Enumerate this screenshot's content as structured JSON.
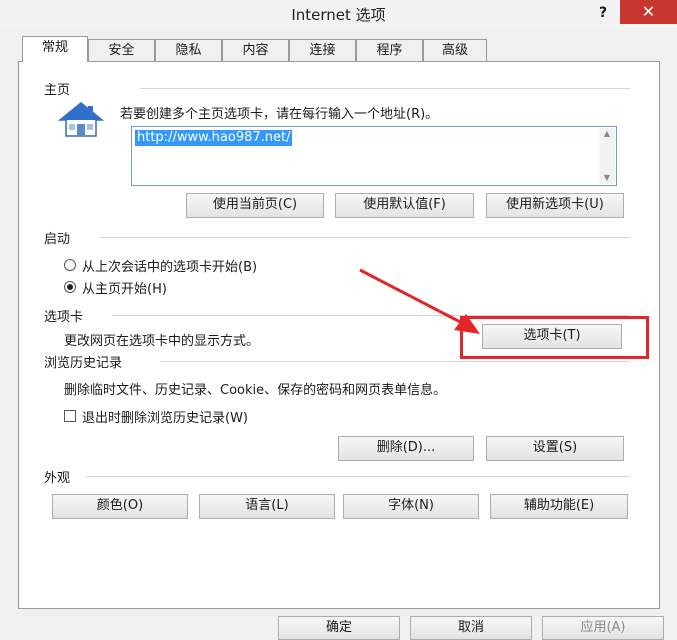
{
  "window": {
    "title": "Internet 选项",
    "help": "?",
    "close": "✕"
  },
  "tabs": [
    "常规",
    "安全",
    "隐私",
    "内容",
    "连接",
    "程序",
    "高级"
  ],
  "homepage": {
    "label": "主页",
    "instruction": "若要创建多个主页选项卡，请在每行输入一个地址(R)。",
    "url": "http://www.hao987.net/",
    "btn_current": "使用当前页(C)",
    "btn_default": "使用默认值(F)",
    "btn_new_tab": "使用新选项卡(U)"
  },
  "startup": {
    "label": "启动",
    "option_last_session": "从上次会话中的选项卡开始(B)",
    "option_homepage": "从主页开始(H)",
    "selected": "homepage"
  },
  "tabs_section": {
    "label": "选项卡",
    "description": "更改网页在选项卡中的显示方式。",
    "button": "选项卡(T)"
  },
  "history": {
    "label": "浏览历史记录",
    "description": "删除临时文件、历史记录、Cookie、保存的密码和网页表单信息。",
    "checkbox_label": "退出时删除浏览历史记录(W)",
    "checkbox_checked": false,
    "btn_delete": "删除(D)...",
    "btn_settings": "设置(S)"
  },
  "appearance": {
    "label": "外观",
    "btn_colors": "颜色(O)",
    "btn_languages": "语言(L)",
    "btn_fonts": "字体(N)",
    "btn_accessibility": "辅助功能(E)"
  },
  "footer": {
    "ok": "确定",
    "cancel": "取消",
    "apply": "应用(A)"
  },
  "colors": {
    "annotation_red": "#e3262a",
    "selection_blue": "#3399ff",
    "close_red": "#c7372f"
  }
}
